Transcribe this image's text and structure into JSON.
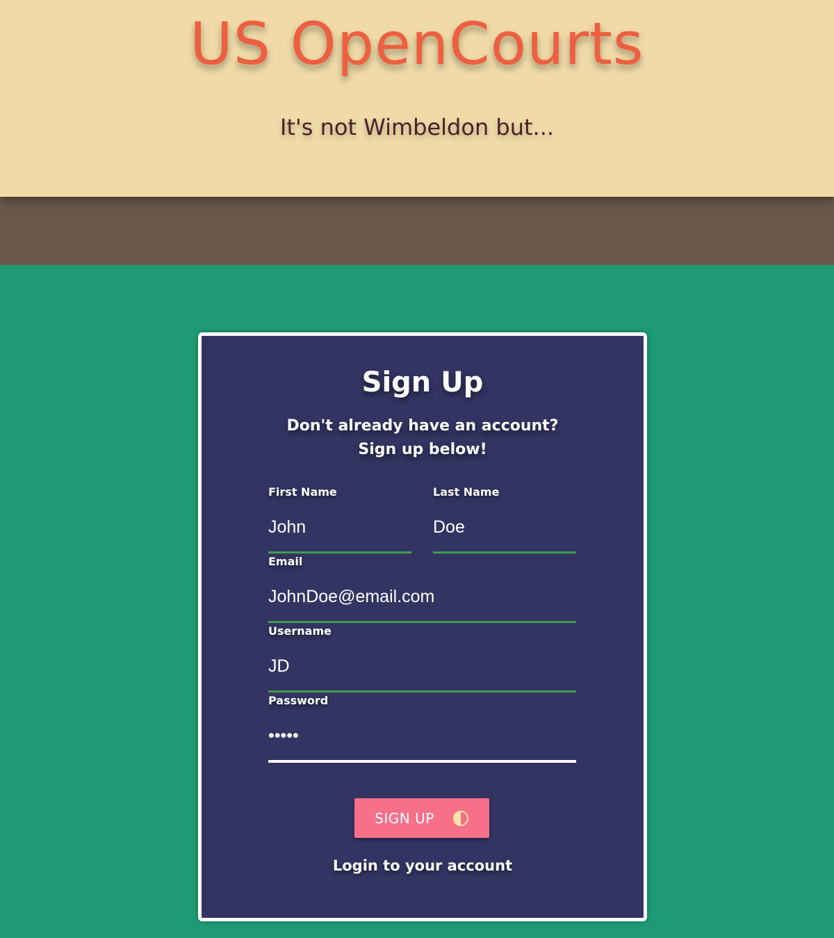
{
  "header": {
    "title": "US OpenCourts",
    "tagline": "It's not Wimbeldon but..."
  },
  "form": {
    "title": "Sign Up",
    "subtitle_line1": "Don't already have an account?",
    "subtitle_line2": "Sign up below!",
    "first_name": {
      "label": "First Name",
      "value": "John"
    },
    "last_name": {
      "label": "Last Name",
      "value": "Doe"
    },
    "email": {
      "label": "Email",
      "value": "JohnDoe@email.com"
    },
    "username": {
      "label": "Username",
      "value": "JD"
    },
    "password": {
      "label": "Password",
      "value": "12345"
    },
    "signup_button": "SIGN UP",
    "login_link": "Login to your account"
  },
  "colors": {
    "header_bg": "#f0dba8",
    "title": "#ee5f3f",
    "band": "#6b584b",
    "page_bg": "#1e9a74",
    "card_bg": "#343463",
    "button": "#f7708a",
    "field_line": "#3aa04a"
  },
  "icons": {
    "button_icon": "half-circle-icon"
  }
}
